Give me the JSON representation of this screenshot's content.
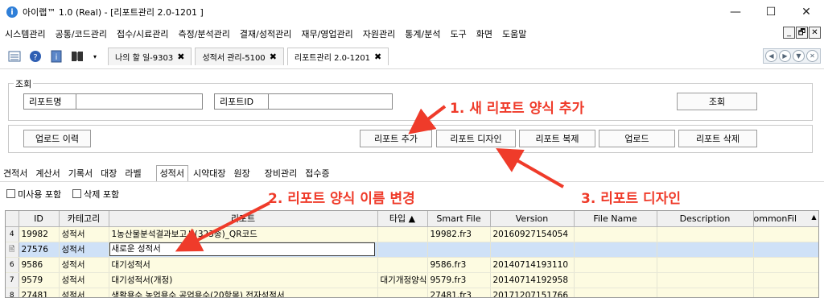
{
  "window": {
    "title": "아이랩™ 1.0 (Real) - [리포트관리 2.0-1201 ]",
    "minimize": "—",
    "maximize": "☐",
    "close": "✕"
  },
  "menu": {
    "items": [
      "시스템관리",
      "공통/코드관리",
      "접수/시료관리",
      "측정/분석관리",
      "결재/성적관리",
      "재무/영업관리",
      "자원관리",
      "통계/분석",
      "도구",
      "화면",
      "도움말"
    ],
    "mdi": [
      "_",
      "🗗",
      "✕"
    ]
  },
  "toolbar": {
    "tabs": [
      {
        "label": "나의 할 일-9303",
        "close": "✖"
      },
      {
        "label": "성적서 관리-5100",
        "close": "✖"
      },
      {
        "label": "리포트관리 2.0-1201",
        "close": "✖"
      }
    ]
  },
  "search": {
    "group_label": "조회",
    "report_name_label": "리포트명",
    "report_name_value": "",
    "report_id_label": "리포트ID",
    "report_id_value": "",
    "search_button": "조회"
  },
  "actions": {
    "upload_history": "업로드 이력",
    "add_report": "리포트 추가",
    "design_report": "리포트 디자인",
    "copy_report": "리포트 복제",
    "upload": "업로드",
    "delete_report": "리포트 삭제"
  },
  "category_tabs": [
    "견적서",
    "계산서",
    "기록서",
    "대장",
    "라벨",
    "성적서",
    "시약대장",
    "원장",
    "장비관리",
    "접수증"
  ],
  "active_category": "성적서",
  "filters": {
    "include_unused": "미사용 포함",
    "include_deleted": "삭제 포함"
  },
  "grid": {
    "columns": [
      "ID",
      "카테고리",
      "리포트",
      "타입 ▲",
      "Smart File",
      "Version",
      "File Name",
      "Description",
      "ommonFil"
    ],
    "rows": [
      {
        "num": "4",
        "id": "19982",
        "category": "성적서",
        "report": "1농산물분석결과보고서(323종)_QR코드",
        "type": "",
        "smart_file": "19982.fr3",
        "version": "20160927154054",
        "state": "normal"
      },
      {
        "num": "🖹",
        "id": "27576",
        "category": "성적서",
        "report": "새로운 성적서",
        "type": "",
        "smart_file": "",
        "version": "",
        "state": "selected"
      },
      {
        "num": "6",
        "id": "9586",
        "category": "성적서",
        "report": "대기성적서",
        "type": "",
        "smart_file": "9586.fr3",
        "version": "20140714193110",
        "state": "normal"
      },
      {
        "num": "7",
        "id": "9579",
        "category": "성적서",
        "report": "대기성적서(개정)",
        "type": "대기개정양식",
        "smart_file": "9579.fr3",
        "version": "20140714192958",
        "state": "normal"
      },
      {
        "num": "8",
        "id": "27481",
        "category": "성적서",
        "report": "생활용수 농업용수 공업용수(20항목) 전자성적서",
        "type": "",
        "smart_file": "27481.fr3",
        "version": "20171207151766",
        "state": "normal"
      }
    ]
  },
  "annotations": {
    "step1": "1. 새 리포트 양식 추가",
    "step2": "2. 리포트 양식 이름 변경",
    "step3": "3. 리포트 디자인",
    "color": "#ef3b2a"
  }
}
